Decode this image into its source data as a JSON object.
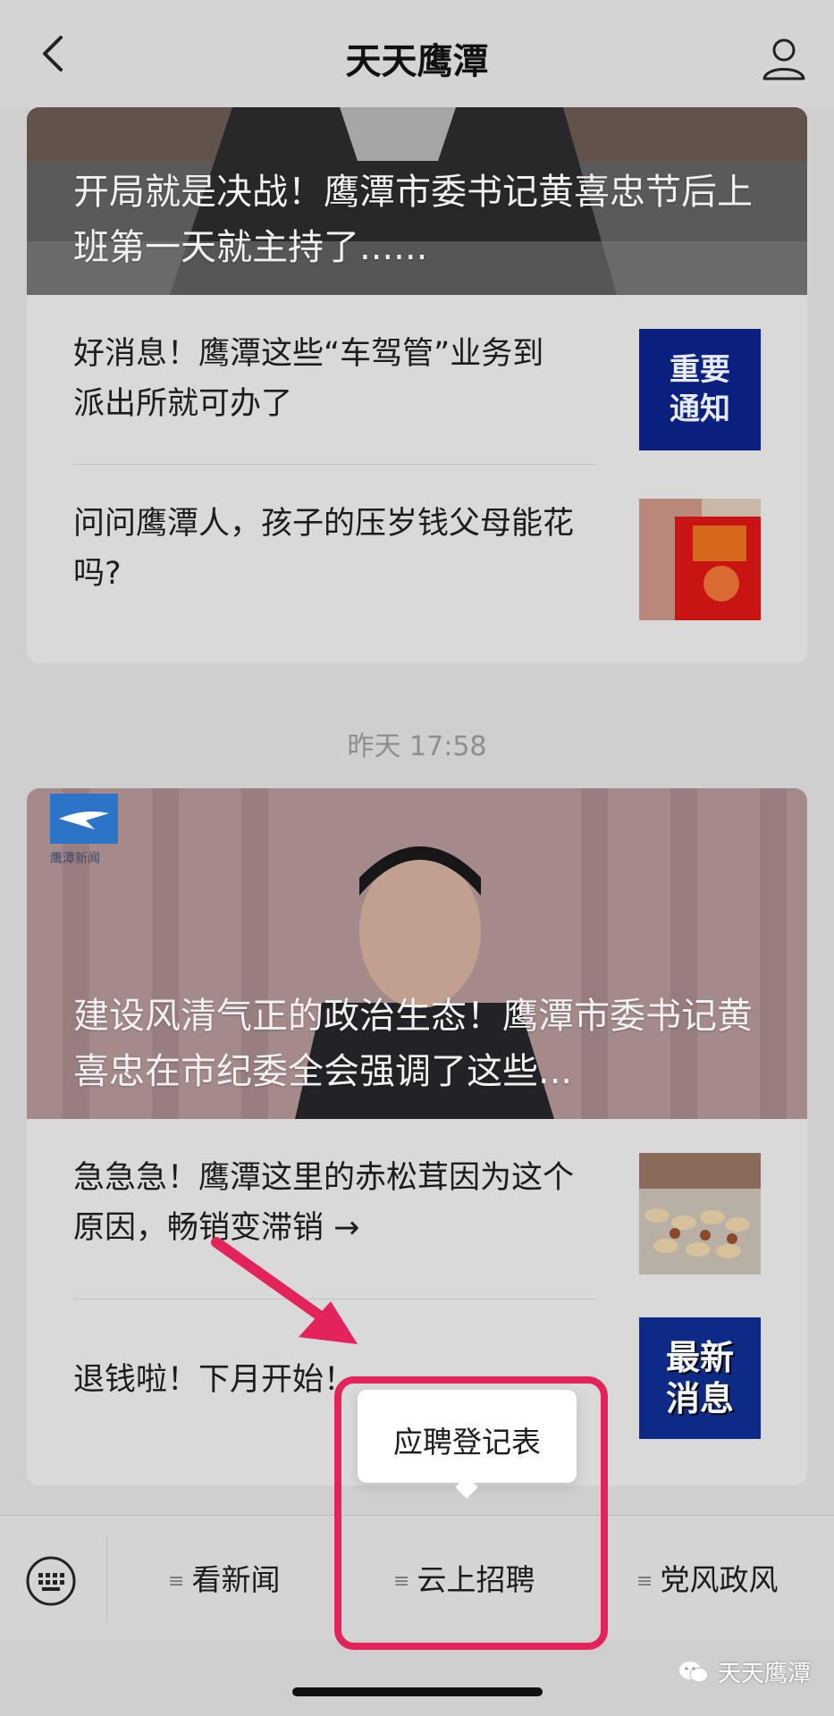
{
  "header": {
    "title": "天天鹰潭"
  },
  "feed": {
    "article_group_1": {
      "hero_title": "开局就是决战！鹰潭市委书记黄喜忠节后上班第一天就主持了......",
      "items": [
        {
          "title": "好消息！鹰潭这些“车驾管”业务到派出所就可办了",
          "thumb_text": "重要\n通知"
        },
        {
          "title": "问问鹰潭人，孩子的压岁钱父母能花吗?"
        }
      ]
    },
    "timestamp": "昨天 17:58",
    "article_group_2": {
      "hero_title": "建设风清气正的政治生态！鹰潭市委书记黄喜忠在市纪委全会强调了这些...",
      "hero_logo_text": "鹰潭新闻",
      "items": [
        {
          "title": "急急急！鹰潭这里的赤松茸因为这个原因，畅销变滞销 →"
        },
        {
          "title": "退钱啦！下月开始！",
          "thumb_text": "最新\n消息"
        }
      ]
    }
  },
  "menu": {
    "items": [
      {
        "label": "看新闻"
      },
      {
        "label": "云上招聘"
      },
      {
        "label": "党风政风"
      }
    ],
    "popup_item": "应聘登记表"
  },
  "watermark": "天天鹰潭",
  "colors": {
    "highlight": "#e2245a",
    "arrow": "#e2245a"
  }
}
